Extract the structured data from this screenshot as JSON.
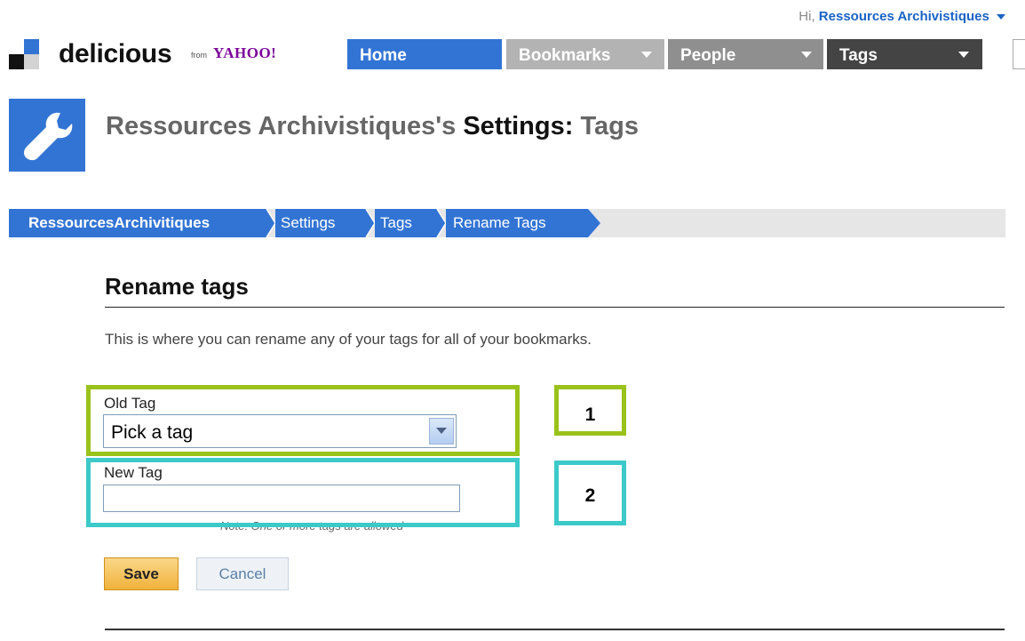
{
  "topbar": {
    "greeting_prefix": "Hi,",
    "username": "Ressources Archivistiques"
  },
  "logo": {
    "name": "delicious",
    "from": "from",
    "partner": "YAHOO!"
  },
  "nav": {
    "home": "Home",
    "bookmarks": "Bookmarks",
    "people": "People",
    "tags": "Tags"
  },
  "header": {
    "owner": "Ressources Archivistiques's",
    "settings": "Settings:",
    "section": "Tags"
  },
  "breadcrumb": [
    "RessourcesArchivitiques",
    "Settings",
    "Tags",
    "Rename Tags"
  ],
  "content": {
    "title": "Rename tags",
    "description": "This is where you can rename any of your tags for all of your bookmarks.",
    "old_tag_label": "Old Tag",
    "old_tag_value": "Pick a tag",
    "new_tag_label": "New Tag",
    "new_tag_value": "",
    "note": "Note: One or more tags are allowed",
    "save": "Save",
    "cancel": "Cancel"
  },
  "annotations": {
    "badge_1": "1",
    "badge_2": "2"
  },
  "colors": {
    "accent_blue": "#3274d4",
    "highlight_green": "#99c21b",
    "highlight_cyan": "#3cc9c9",
    "save_orange": "#f0b23b"
  }
}
